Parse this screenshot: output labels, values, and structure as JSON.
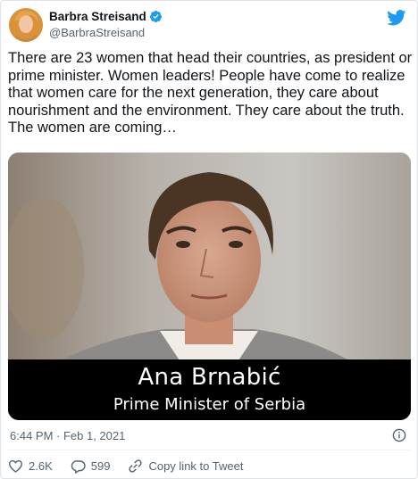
{
  "author": {
    "display_name": "Barbra Streisand",
    "handle": "@BarbraStreisand",
    "verified_icon": "verified-badge-icon"
  },
  "tweet": {
    "text": "There are 23 women that head their countries, as president or prime minister. Women leaders! People have come to realize that women care for the next generation, they care about nourishment and the environment. They care about the truth. The women are coming…"
  },
  "media": {
    "caption_name": "Ana Brnabić",
    "caption_title": "Prime Minister of Serbia"
  },
  "meta": {
    "timestamp": "6:44 PM · Feb 1, 2021"
  },
  "actions": {
    "likes": "2.6K",
    "replies": "599",
    "copy_link": "Copy link to Tweet"
  },
  "colors": {
    "accent": "#1d9bf0",
    "muted": "#536471",
    "text": "#0f1419"
  }
}
